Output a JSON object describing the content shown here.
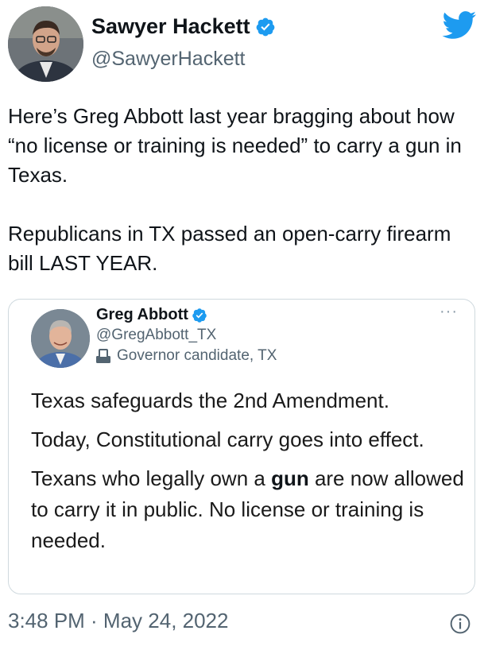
{
  "author": {
    "name": "Sawyer Hackett",
    "handle": "@SawyerHackett"
  },
  "tweet": {
    "paragraph_1": "Here’s Greg Abbott last year bragging about how “no license or training is needed” to carry a gun in Texas.",
    "paragraph_2": "Republicans in TX passed an open-carry firearm bill LAST YEAR."
  },
  "quoted": {
    "name": "Greg Abbott",
    "handle": "@GregAbbott_TX",
    "label": "Governor candidate, TX",
    "more": "···",
    "line_1": "Texas safeguards the 2nd Amendment.",
    "line_2": "Today, Constitutional carry goes into effect.",
    "line_3_pre": "Texans who legally own a ",
    "line_3_bold": "gun",
    "line_3_post": " are now allowed to carry it in public. No license or training is needed."
  },
  "meta": {
    "timestamp": "3:48 PM · May 24, 2022"
  },
  "colors": {
    "verified": "#1d9bf0",
    "twitter_blue": "#1d9bf0",
    "secondary_text": "#536471",
    "border": "#cfd9de"
  },
  "icons": {
    "verified": "verified-badge-icon",
    "bird": "twitter-bird-icon",
    "ballot": "ballot-box-icon",
    "info": "info-icon"
  }
}
